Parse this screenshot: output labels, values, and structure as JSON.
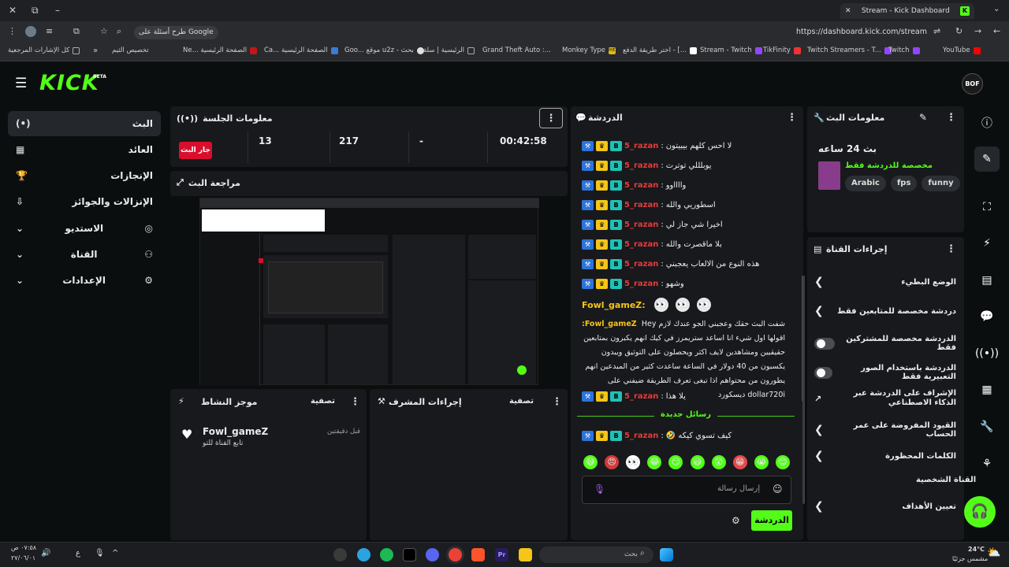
{
  "browser": {
    "tab_title": "Stream - Kick Dashboard",
    "url": "https://dashboard.kick.com/stream",
    "google_ask": "طرح أسئلة على Google",
    "bookmarks": [
      "كل الإشارات المرجعية",
      "تخصيص الثيم",
      "Ne... الصفحة الرئيسية",
      "Ca... الصفحة الرئيسية",
      "Goo... موقع u2z - بحث",
      "الرئيسية | سلة",
      "Grand Theft Auto :...",
      "Monkey Type",
      "اختر طريقة الدفع - [...",
      "Stream - Twitch",
      "TikFinity",
      "Twitch Streamers - T...",
      "Twitch",
      "YouTube"
    ]
  },
  "header": {
    "logo": "KICK",
    "beta": "BETA",
    "avatar": "BOF"
  },
  "nav": [
    {
      "label": "البث",
      "icon": "(•)"
    },
    {
      "label": "العائد",
      "icon": "▦"
    },
    {
      "label": "الإنجازات",
      "icon": "🏆"
    },
    {
      "label": "الإنزالات والجوائز",
      "icon": "⇩"
    },
    {
      "label": "الاستديو",
      "icon": "◎"
    },
    {
      "label": "القناة",
      "icon": "⚇"
    },
    {
      "label": "الإعدادات",
      "icon": "⚙"
    }
  ],
  "session": {
    "title": "معلومات الجلسة",
    "end_button": "جار البث",
    "stats": [
      "13",
      "217",
      "-",
      "00:42:58"
    ]
  },
  "preview": {
    "title": "مراجعة البث"
  },
  "activity": {
    "title": "موجز النشاط",
    "filter": "تصفية",
    "item_name": "Fowl_gameZ",
    "item_time": "قبل دقيقتين",
    "item_desc": "تابع القناة للتو"
  },
  "mod_actions": {
    "title": "إجراءات المشرف",
    "filter": "تصفية"
  },
  "chat": {
    "title": "الدردشة",
    "messages": [
      {
        "user": "5_razan",
        "text": "لا احس كلهم بيبيتون"
      },
      {
        "user": "5_razan",
        "text": "يوبلللي توترت"
      },
      {
        "user": "5_razan",
        "text": "وااااوو"
      },
      {
        "user": "5_razan",
        "text": "اسطوريي والله"
      },
      {
        "user": "5_razan",
        "text": "اخيرا شي جاز لي"
      },
      {
        "user": "5_razan",
        "text": "بلا ماقصرت والله"
      },
      {
        "user": "5_razan",
        "text": "هذه النوع من الالعاب يعجبني"
      },
      {
        "user": "5_razan",
        "text": "وشهو"
      }
    ],
    "fowl_user": "Fowl_gameZ:",
    "fowl_long": "Hey شفت البث حقك وعجبني الجو عندك لازم اقولها اول شيء انا اساعد ستريمرز في كيك انهم يكبرون بمتابعين حقيقيين ومشاهدين لايف اكثر ويحصلون على التوثيق ويبدون يكسبون من 40 دولار في الساعة ساعدت كثير من المبدعين انهم يطورون من محتواهم اذا تبغى تعرف الطريقة ضيفني على ديسكورد dollar720i",
    "last_old": {
      "user": "5_razan",
      "text": "يلا هذا"
    },
    "new_messages_label": "رسائل جديدة",
    "new_msg": {
      "user": "5_razan",
      "text": "كيف تسوي كيكه 🤣"
    },
    "placeholder": "إرسال رسالة",
    "send": "الدردشة"
  },
  "stream_info": {
    "title": "معلومات البث",
    "stream_title": "بث 24 ساعه",
    "category": "مخصصة للدردشة فقط",
    "tags": [
      "Arabic",
      "fps",
      "funny"
    ]
  },
  "channel_actions": {
    "title": "إجراءات القناة",
    "items": [
      {
        "label": "الوضع البطيء",
        "type": "chevron"
      },
      {
        "label": "دردشة مخصصة للمتابعين فقط",
        "type": "chevron"
      },
      {
        "label": "الدردشة مخصصة للمشتركين فقط",
        "type": "toggle"
      },
      {
        "label": "الدردشة باستخدام الصور التعبيرية فقط",
        "type": "toggle"
      },
      {
        "label": "الإشراف على الدردشة عبر الذكاء الاصطناعي",
        "type": "external"
      },
      {
        "label": "القيود المفروضة على عمر الحساب",
        "type": "chevron"
      },
      {
        "label": "الكلمات المحظورة",
        "type": "chevron"
      }
    ],
    "section": "القناة الشخصية",
    "goals": "تعيين الأهداف"
  },
  "taskbar": {
    "weather_temp": "24°C",
    "weather_desc": "مشمس جزئيًا",
    "search": "بحث",
    "time": "٠٧:٥٨ ص",
    "date": "٢٧/٠٦/٠١",
    "lang": "ع"
  }
}
